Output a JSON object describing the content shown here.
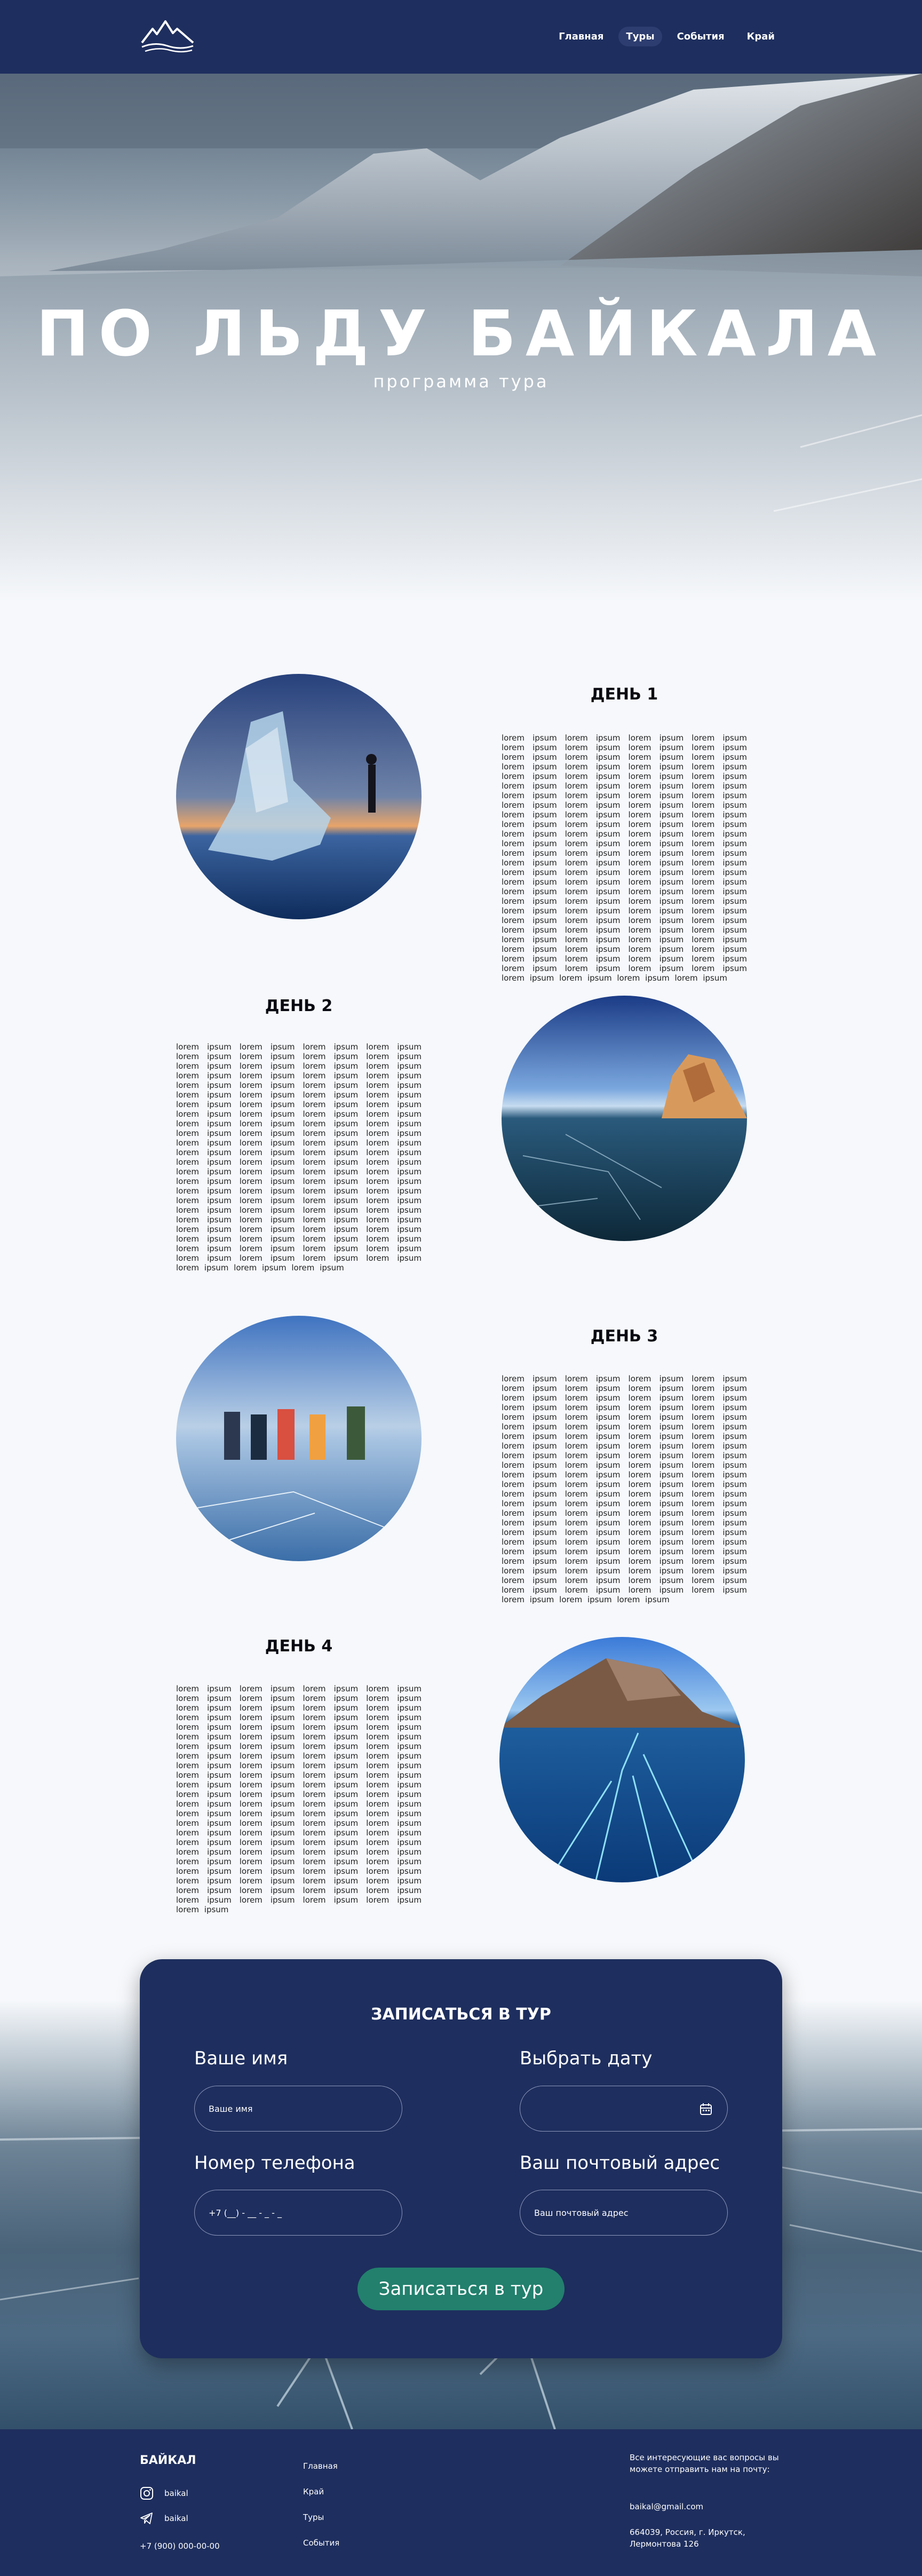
{
  "nav": {
    "items": [
      {
        "label": "Главная",
        "active": false
      },
      {
        "label": "Туры",
        "active": true
      },
      {
        "label": "События",
        "active": false
      },
      {
        "label": "Край",
        "active": false
      }
    ]
  },
  "hero": {
    "title": "ПО ЛЬДУ БАЙКАЛА",
    "subtitle": "программа тура"
  },
  "days": [
    {
      "title": "ДЕНЬ 1",
      "text": "lorem ipsum lorem ipsum lorem ipsum lorem ipsum lorem ipsum lorem ipsum lorem ipsum lorem ipsum lorem ipsum lorem ipsum lorem ipsum lorem ipsum lorem ipsum lorem ipsum lorem ipsum lorem ipsum lorem ipsum lorem ipsum lorem ipsum lorem ipsum lorem ipsum lorem ipsum lorem ipsum lorem ipsum lorem ipsum lorem ipsum lorem ipsum lorem ipsum lorem ipsum lorem ipsum lorem ipsum lorem ipsum lorem ipsum lorem ipsum lorem ipsum lorem ipsum lorem ipsum lorem ipsum lorem ipsum lorem ipsum lorem ipsum lorem ipsum lorem ipsum lorem ipsum lorem ipsum lorem ipsum lorem ipsum lorem ipsum lorem ipsum lorem ipsum lorem ipsum lorem ipsum lorem ipsum lorem ipsum lorem ipsum lorem ipsum lorem ipsum lorem ipsum lorem ipsum lorem ipsum lorem ipsum lorem ipsum lorem ipsum lorem ipsum lorem ipsum lorem ipsum lorem ipsum lorem ipsum lorem ipsum lorem ipsum lorem ipsum lorem ipsum lorem ipsum lorem ipsum lorem ipsum lorem ipsum lorem ipsum lorem ipsum lorem ipsum lorem ipsum lorem ipsum lorem ipsum lorem ipsum lorem ipsum lorem ipsum lorem ipsum lorem ipsum lorem ipsum lorem ipsum lorem ipsum lorem ipsum lorem ipsum lorem ipsum lorem ipsum lorem ipsum lorem ipsum lorem ipsum lorem ipsum lorem ipsum lorem ipsum lorem ipsum lorem ipsum lorem ipsum lorem ipsum"
    },
    {
      "title": "ДЕНЬ 2",
      "text": "lorem ipsum lorem ipsum lorem ipsum lorem ipsum lorem ipsum lorem ipsum lorem ipsum lorem ipsum lorem ipsum lorem ipsum lorem ipsum lorem ipsum lorem ipsum lorem ipsum lorem ipsum lorem ipsum lorem ipsum lorem ipsum lorem ipsum lorem ipsum lorem ipsum lorem ipsum lorem ipsum lorem ipsum lorem ipsum lorem ipsum lorem ipsum lorem ipsum lorem ipsum lorem ipsum lorem ipsum lorem ipsum lorem ipsum lorem ipsum lorem ipsum lorem ipsum lorem ipsum lorem ipsum lorem ipsum lorem ipsum lorem ipsum lorem ipsum lorem ipsum lorem ipsum lorem ipsum lorem ipsum lorem ipsum lorem ipsum lorem ipsum lorem ipsum lorem ipsum lorem ipsum lorem ipsum lorem ipsum lorem ipsum lorem ipsum lorem ipsum lorem ipsum lorem ipsum lorem ipsum lorem ipsum lorem ipsum lorem ipsum lorem ipsum lorem ipsum lorem ipsum lorem ipsum lorem ipsum lorem ipsum lorem ipsum lorem ipsum lorem ipsum lorem ipsum lorem ipsum lorem ipsum lorem ipsum lorem ipsum lorem ipsum lorem ipsum lorem ipsum lorem ipsum lorem ipsum lorem ipsum lorem ipsum lorem ipsum lorem ipsum lorem ipsum lorem ipsum lorem ipsum lorem ipsum lorem ipsum lorem ipsum lorem ipsum lorem ipsum lorem ipsum"
    },
    {
      "title": "ДЕНЬ 3",
      "text": "lorem ipsum lorem ipsum lorem ipsum lorem ipsum lorem ipsum lorem ipsum lorem ipsum lorem ipsum lorem ipsum lorem ipsum lorem ipsum lorem ipsum lorem ipsum lorem ipsum lorem ipsum lorem ipsum lorem ipsum lorem ipsum lorem ipsum lorem ipsum lorem ipsum lorem ipsum lorem ipsum lorem ipsum lorem ipsum lorem ipsum lorem ipsum lorem ipsum lorem ipsum lorem ipsum lorem ipsum lorem ipsum lorem ipsum lorem ipsum lorem ipsum lorem ipsum lorem ipsum lorem ipsum lorem ipsum lorem ipsum lorem ipsum lorem ipsum lorem ipsum lorem ipsum lorem ipsum lorem ipsum lorem ipsum lorem ipsum lorem ipsum lorem ipsum lorem ipsum lorem ipsum lorem ipsum lorem ipsum lorem ipsum lorem ipsum lorem ipsum lorem ipsum lorem ipsum lorem ipsum lorem ipsum lorem ipsum lorem ipsum lorem ipsum lorem ipsum lorem ipsum lorem ipsum lorem ipsum lorem ipsum lorem ipsum lorem ipsum lorem ipsum lorem ipsum lorem ipsum lorem ipsum lorem ipsum lorem ipsum lorem ipsum lorem ipsum lorem ipsum lorem ipsum lorem ipsum lorem ipsum lorem ipsum lorem ipsum lorem ipsum lorem ipsum lorem ipsum lorem ipsum lorem ipsum lorem ipsum lorem ipsum lorem ipsum lorem ipsum lorem ipsum"
    },
    {
      "title": "ДЕНЬ 4",
      "text": "lorem ipsum lorem ipsum lorem ipsum lorem ipsum lorem ipsum lorem ipsum lorem ipsum lorem ipsum lorem ipsum lorem ipsum lorem ipsum lorem ipsum lorem ipsum lorem ipsum lorem ipsum lorem ipsum lorem ipsum lorem ipsum lorem ipsum lorem ipsum lorem ipsum lorem ipsum lorem ipsum lorem ipsum lorem ipsum lorem ipsum lorem ipsum lorem ipsum lorem ipsum lorem ipsum lorem ipsum lorem ipsum lorem ipsum lorem ipsum lorem ipsum lorem ipsum lorem ipsum lorem ipsum lorem ipsum lorem ipsum lorem ipsum lorem ipsum lorem ipsum lorem ipsum lorem ipsum lorem ipsum lorem ipsum lorem ipsum lorem ipsum lorem ipsum lorem ipsum lorem ipsum lorem ipsum lorem ipsum lorem ipsum lorem ipsum lorem ipsum lorem ipsum lorem ipsum lorem ipsum lorem ipsum lorem ipsum lorem ipsum lorem ipsum lorem ipsum lorem ipsum lorem ipsum lorem ipsum lorem ipsum lorem ipsum lorem ipsum lorem ipsum lorem ipsum lorem ipsum lorem ipsum lorem ipsum lorem ipsum lorem ipsum lorem ipsum lorem ipsum lorem ipsum lorem ipsum lorem ipsum lorem ipsum lorem ipsum lorem ipsum lorem ipsum lorem ipsum lorem ipsum lorem ipsum lorem ipsum lorem ipsum lorem ipsum"
    }
  ],
  "signup": {
    "title": "ЗАПИСАТЬСЯ В ТУР",
    "name_label": "Ваше имя",
    "name_placeholder": "Ваше имя",
    "date_label": "Выбрать дату",
    "phone_label": "Номер телефона",
    "phone_placeholder": "+7 (__) - __ - _ - _",
    "email_label": "Ваш почтовый адрес",
    "email_placeholder": "Ваш почтовый адрес",
    "submit_label": "Записаться в тур"
  },
  "footer": {
    "brand": "БАЙКАЛ",
    "instagram": "baikal",
    "telegram": "baikal",
    "phone": "+7 (900) 000-00-00",
    "links": [
      "Главная",
      "Край",
      "Туры",
      "События"
    ],
    "contact_note": "Все интересующие вас вопросы вы можете отправить нам на почту:",
    "email": "baikal@gmail.com",
    "address": "664039, Россия, г. Иркутск, Лермонтова 126"
  },
  "colors": {
    "primary": "#1e2e5e",
    "accent": "#22806d",
    "background": "#f6f8fb"
  }
}
